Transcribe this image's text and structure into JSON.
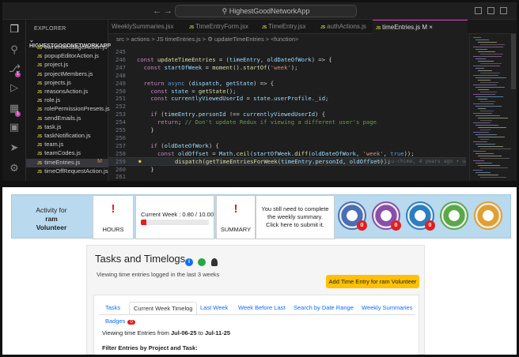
{
  "vscode": {
    "search_text": "HighestGoodNetworkApp",
    "explorer_label": "EXPLORER",
    "project_label": "HIGHESTGOODNETWORKAPP",
    "file_type_label": "JS",
    "modified_marker": "M",
    "files": [
      {
        "name": "ownerMessageAction.js"
      },
      {
        "name": "popupEditorAction.js"
      },
      {
        "name": "project.js"
      },
      {
        "name": "projectMembers.js"
      },
      {
        "name": "projects.js"
      },
      {
        "name": "reasonsAction.js"
      },
      {
        "name": "role.js"
      },
      {
        "name": "rolePermissionPresets.js"
      },
      {
        "name": "sendEmails.js"
      },
      {
        "name": "task.js"
      },
      {
        "name": "taskNotification.js"
      },
      {
        "name": "team.js"
      },
      {
        "name": "teamCodes.js"
      },
      {
        "name": "timeEntries.js",
        "active": true,
        "modified": "M"
      },
      {
        "name": "timeOffRequestAction.js"
      }
    ],
    "tabs": [
      {
        "label": "WeeklySummaries.jsx"
      },
      {
        "label": "TimeEntryForm.jsx"
      },
      {
        "label": "TimeEntry.jsx"
      },
      {
        "label": "authActions.js"
      },
      {
        "label": "timeEntries.js M",
        "active": true
      }
    ],
    "breadcrumb": "src > actions > JS timeEntries.js > ⚙ updateTimeEntries > <function>",
    "blame": "sylvia-Liu-chime, 4 years ago • update",
    "code_lines": [
      {
        "n": "245",
        "html": ""
      },
      {
        "n": "246",
        "html": "<span class='k'>const</span> <span class='f'>updateTimeEntries</span> <span class='p'>= (</span><span class='v'>timeEntry</span><span class='p'>,</span> <span class='v'>oldDateOfWork</span><span class='p'>) =&gt; {</span>"
      },
      {
        "n": "247",
        "html": "  <span class='k'>const</span> <span class='v'>startOfWeek</span> <span class='p'>=</span> <span class='f'>moment</span><span class='p'>().</span><span class='f'>startOf</span><span class='p'>(</span><span class='s'>'week'</span><span class='p'>);</span>"
      },
      {
        "n": "248",
        "html": ""
      },
      {
        "n": "249",
        "html": "  <span class='k'>return</span> <span class='b'>async</span> <span class='p'>(</span><span class='v'>dispatch</span><span class='p'>,</span> <span class='v'>getState</span><span class='p'>) =&gt; {</span>"
      },
      {
        "n": "250",
        "html": "    <span class='k'>const</span> <span class='v'>state</span> <span class='p'>=</span> <span class='f'>getState</span><span class='p'>();</span>"
      },
      {
        "n": "251",
        "html": "    <span class='k'>const</span> <span class='v'>currentlyViewedUserId</span> <span class='p'>=</span> <span class='v'>state</span><span class='p'>.</span><span class='v'>userProfile</span><span class='p'>.</span><span class='v'>_id</span><span class='p'>;</span>"
      },
      {
        "n": "252",
        "html": ""
      },
      {
        "n": "253",
        "html": "    <span class='k'>if</span> <span class='p'>(</span><span class='v'>timeEntry</span><span class='p'>.</span><span class='v'>personId</span> <span class='p'>!==</span> <span class='v'>currentlyViewedUserId</span><span class='p'>) {</span>"
      },
      {
        "n": "254",
        "html": "      <span class='k'>return</span><span class='p'>;</span> <span class='c'>// Don't update Redux if viewing a different user's page</span>"
      },
      {
        "n": "255",
        "html": "    <span class='p'>}</span>"
      },
      {
        "n": "256",
        "html": ""
      },
      {
        "n": "257",
        "html": "    <span class='k'>if</span> <span class='p'>(</span><span class='v'>oldDateOfWork</span><span class='p'>) {</span>"
      },
      {
        "n": "258",
        "html": "      <span class='k'>const</span> <span class='v'>oldOffset</span> <span class='p'>=</span> <span class='v'>Math</span><span class='p'>.</span><span class='f'>ceil</span><span class='p'>(</span><span class='v'>startOfWeek</span><span class='p'>.</span><span class='f'>diff</span><span class='p'>(</span><span class='v'>oldDateOfWork</span><span class='p'>,</span> <span class='s'>'week'</span><span class='p'>,</span> <span class='b'>true</span><span class='p'>));</span>"
      },
      {
        "n": "259",
        "html": "      <span class='f'>dispatch</span><span class='p'>(</span><span class='f'>getTimeEntriesForWeek</span><span class='p'>(</span><span class='v'>timeEntry</span><span class='p'>.</span><span class='v'>personId</span><span class='p'>,</span> <span class='v'>oldOffset</span><span class='p'>));</span>",
        "current": true
      },
      {
        "n": "260",
        "html": "    <span class='p'>}</span>"
      },
      {
        "n": "261",
        "html": ""
      }
    ]
  },
  "app": {
    "activity_line1": "Activity for",
    "activity_name": "ram",
    "activity_role": "Volunteer",
    "exclaim": "!",
    "hours_label": "HOURS",
    "current_week_text": "Current Week : 0.80 / 10.00",
    "current_week_progress": 0.08,
    "summary_label": "SUMMARY",
    "reminder": "You still need to complete the weekly summary. Click here to submit it.",
    "badges": [
      {
        "icon": "badge-icon",
        "count": "0",
        "color": "#4a6fb5"
      },
      {
        "icon": "badge-icon",
        "count": "0",
        "color": "#8a4fa8"
      },
      {
        "icon": "badge-icon",
        "count": "0",
        "color": "#2a7fc4"
      },
      {
        "icon": "badge-icon",
        "count": "",
        "color": "#5aa84a"
      },
      {
        "icon": "badge-icon",
        "count": "",
        "color": "#e0a030"
      }
    ],
    "panel_title": "Tasks and Timelogs",
    "panel_sub": "Viewing time entries logged in the last 3 weeks",
    "add_button": "Add Time Entry for ram Volunteer",
    "tabs": [
      "Tasks",
      "Current Week Timelog",
      "Last Week",
      "Week Before Last",
      "Search by Date Range",
      "Weekly Summaries"
    ],
    "badges_tab": "Badges",
    "badges_count": "0",
    "viewing_prefix": "Viewing time Entries from ",
    "from_date": "Jul-06-25",
    "to_word": " to ",
    "to_date": "Jul-11-25",
    "filter_label": "Filter Entries by Project and Task:"
  }
}
